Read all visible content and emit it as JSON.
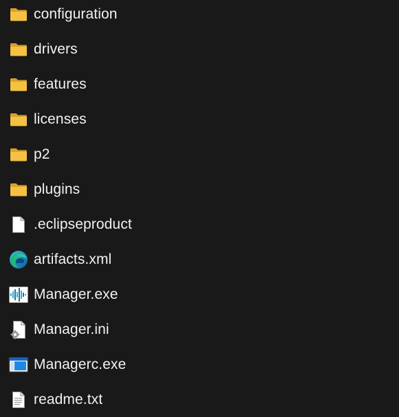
{
  "explorer": {
    "items": [
      {
        "name": "configuration",
        "type": "folder",
        "icon": "folder-icon"
      },
      {
        "name": "drivers",
        "type": "folder",
        "icon": "folder-icon"
      },
      {
        "name": "features",
        "type": "folder",
        "icon": "folder-icon"
      },
      {
        "name": "licenses",
        "type": "folder",
        "icon": "folder-icon"
      },
      {
        "name": "p2",
        "type": "folder",
        "icon": "folder-icon"
      },
      {
        "name": "plugins",
        "type": "folder",
        "icon": "folder-icon"
      },
      {
        "name": ".eclipseproduct",
        "type": "file",
        "icon": "blank-file-icon"
      },
      {
        "name": "artifacts.xml",
        "type": "file",
        "icon": "edge-browser-icon"
      },
      {
        "name": "Manager.exe",
        "type": "file",
        "icon": "waveform-app-icon"
      },
      {
        "name": "Manager.ini",
        "type": "file",
        "icon": "settings-file-icon"
      },
      {
        "name": "Managerc.exe",
        "type": "file",
        "icon": "console-app-icon"
      },
      {
        "name": "readme.txt",
        "type": "file",
        "icon": "text-file-icon"
      }
    ]
  },
  "colors": {
    "background": "#191919",
    "text": "#f2f2f2",
    "folder": "#f5c143"
  }
}
